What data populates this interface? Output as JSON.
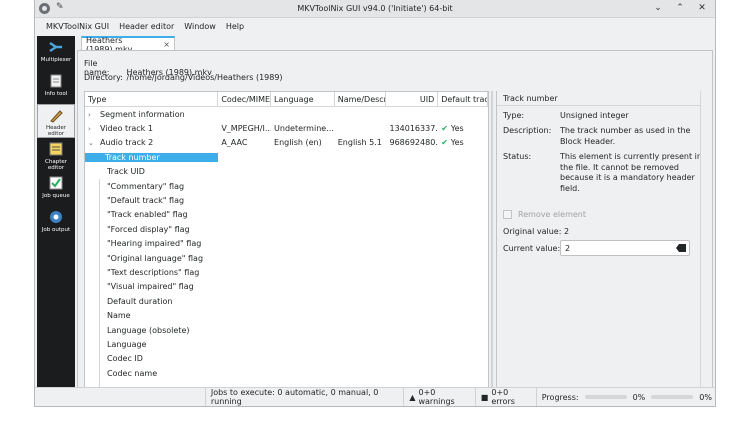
{
  "window": {
    "title": "MKVToolNix GUI v94.0 ('Initiate') 64-bit"
  },
  "menu": [
    "MKVToolNix GUI",
    "Header editor",
    "Window",
    "Help"
  ],
  "sidebar": [
    {
      "label": "Multiplexer",
      "icon": "multiplexer-icon",
      "active": false
    },
    {
      "label": "Info tool",
      "icon": "info-tool-icon",
      "active": false
    },
    {
      "label": "Header editor",
      "icon": "header-editor-icon",
      "active": true
    },
    {
      "label": "Chapter editor",
      "icon": "chapter-editor-icon",
      "active": false
    },
    {
      "label": "Job queue",
      "icon": "job-queue-icon",
      "active": false
    },
    {
      "label": "Job output",
      "icon": "job-output-icon",
      "active": false
    }
  ],
  "tab": {
    "label": "Heathers (1989).mkv",
    "close": "×"
  },
  "file": {
    "name_label": "File name:",
    "name": "Heathers (1989).mkv",
    "dir_label": "Directory:",
    "dir": "/home/jordang/Videos/Heathers (1989)"
  },
  "tree": {
    "columns": [
      "Type",
      "Codec/MIME",
      "Language",
      "Name/Descr",
      "UID",
      "Default trac"
    ],
    "rows": [
      {
        "level": 0,
        "arrow": "›",
        "cells": [
          "Segment information",
          "",
          "",
          "",
          "",
          ""
        ]
      },
      {
        "level": 0,
        "arrow": "›",
        "cells": [
          "Video track 1",
          "V_MPEGH/I...",
          "Undetermine...",
          "",
          "134016337...",
          "Yes"
        ],
        "check": true
      },
      {
        "level": 0,
        "arrow": "⌄",
        "cells": [
          "Audio track 2",
          "A_AAC",
          "English (en)",
          "English 5.1",
          "968692480...",
          "Yes"
        ],
        "check": true
      },
      {
        "level": 1,
        "selected": true,
        "cells": [
          "Track number",
          "",
          "",
          "",
          "",
          ""
        ]
      },
      {
        "level": 1,
        "cells": [
          "Track UID",
          "",
          "",
          "",
          "",
          ""
        ]
      },
      {
        "level": 1,
        "cells": [
          "\"Commentary\" flag",
          "",
          "",
          "",
          "",
          ""
        ]
      },
      {
        "level": 1,
        "cells": [
          "\"Default track\" flag",
          "",
          "",
          "",
          "",
          ""
        ]
      },
      {
        "level": 1,
        "cells": [
          "\"Track enabled\" flag",
          "",
          "",
          "",
          "",
          ""
        ]
      },
      {
        "level": 1,
        "cells": [
          "\"Forced display\" flag",
          "",
          "",
          "",
          "",
          ""
        ]
      },
      {
        "level": 1,
        "cells": [
          "\"Hearing impaired\" flag",
          "",
          "",
          "",
          "",
          ""
        ]
      },
      {
        "level": 1,
        "cells": [
          "\"Original language\" flag",
          "",
          "",
          "",
          "",
          ""
        ]
      },
      {
        "level": 1,
        "cells": [
          "\"Text descriptions\" flag",
          "",
          "",
          "",
          "",
          ""
        ]
      },
      {
        "level": 1,
        "cells": [
          "\"Visual impaired\" flag",
          "",
          "",
          "",
          "",
          ""
        ]
      },
      {
        "level": 1,
        "cells": [
          "Default duration",
          "",
          "",
          "",
          "",
          ""
        ]
      },
      {
        "level": 1,
        "cells": [
          "Name",
          "",
          "",
          "",
          "",
          ""
        ]
      },
      {
        "level": 1,
        "cells": [
          "Language (obsolete)",
          "",
          "",
          "",
          "",
          ""
        ]
      },
      {
        "level": 1,
        "cells": [
          "Language",
          "",
          "",
          "",
          "",
          ""
        ]
      },
      {
        "level": 1,
        "cells": [
          "Codec ID",
          "",
          "",
          "",
          "",
          ""
        ]
      },
      {
        "level": 1,
        "cells": [
          "Codec name",
          "",
          "",
          "",
          "",
          ""
        ]
      }
    ]
  },
  "details": {
    "header": "Track number",
    "type_label": "Type:",
    "type": "Unsigned integer",
    "desc_label": "Description:",
    "desc": "The track number as used in the Block Header.",
    "status_label": "Status:",
    "status": "This element is currently present in the file. It cannot be removed because it is a mandatory header field.",
    "remove_label": "Remove element",
    "orig_label": "Original value:",
    "orig_value": "2",
    "current_label": "Current value:",
    "current_value": "2"
  },
  "status": {
    "jobs": "Jobs to execute:  0 automatic, 0 manual, 0 running",
    "warnings": "0+0 warnings",
    "errors": "0+0 errors",
    "progress_label": "Progress:",
    "progress1": "0%",
    "progress2": "0%"
  },
  "colors": {
    "accent": "#3daee9",
    "check": "#27ae60",
    "sidebar": "#1b1c1e"
  }
}
